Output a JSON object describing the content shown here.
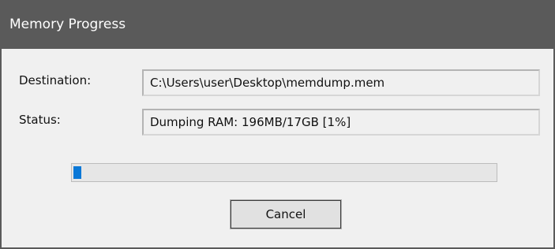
{
  "window": {
    "title": "Memory Progress"
  },
  "form": {
    "destination_label": "Destination:",
    "destination_value": "C:\\Users\\user\\Desktop\\memdump.mem",
    "status_label": "Status:",
    "status_value": "Dumping RAM: 196MB/17GB [1%]"
  },
  "progress": {
    "percent": 1,
    "fill_color": "#0a78d7"
  },
  "buttons": {
    "cancel_label": "Cancel"
  }
}
